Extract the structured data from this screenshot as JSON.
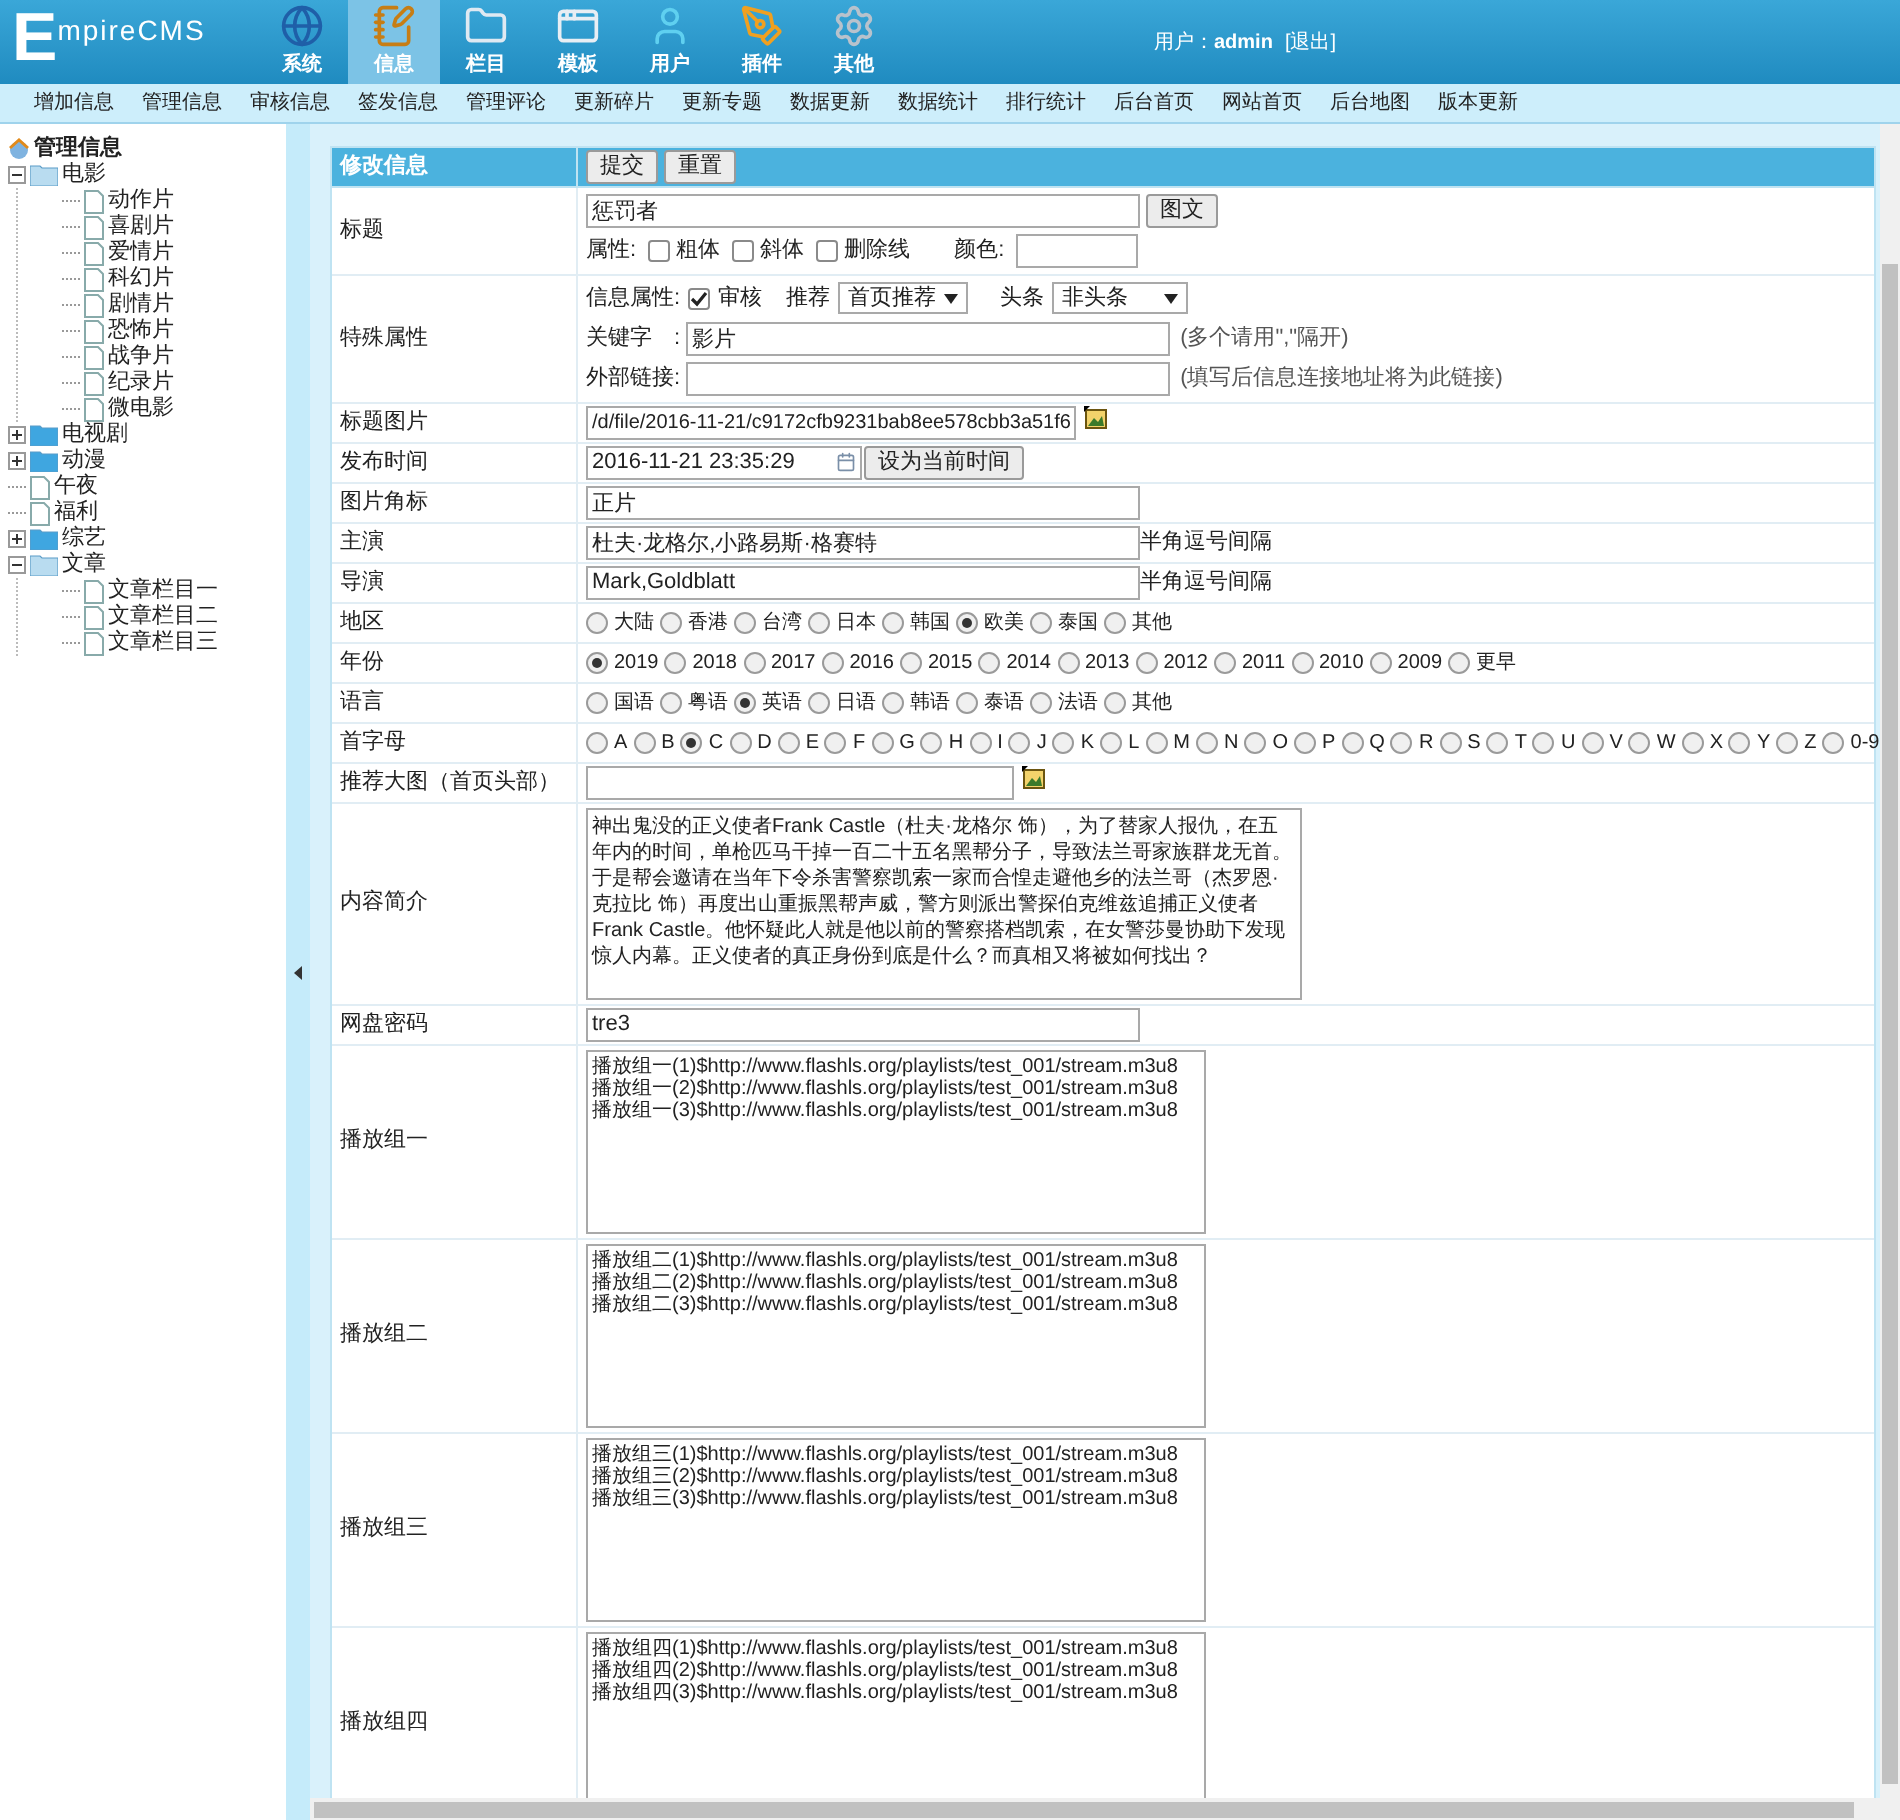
{
  "header": {
    "logo_initial": "E",
    "logo_rest": "mpireCMS",
    "nav": [
      {
        "label": "系统",
        "kind": "globe",
        "selected": false
      },
      {
        "label": "信息",
        "kind": "note",
        "selected": true
      },
      {
        "label": "栏目",
        "kind": "folder",
        "selected": false
      },
      {
        "label": "模板",
        "kind": "window",
        "selected": false
      },
      {
        "label": "用户",
        "kind": "user",
        "selected": false
      },
      {
        "label": "插件",
        "kind": "tools",
        "selected": false
      },
      {
        "label": "其他",
        "kind": "gear",
        "selected": false
      }
    ],
    "user_label": "用户：",
    "user_name": "admin",
    "logout": "[退出]"
  },
  "submenu": [
    "增加信息",
    "管理信息",
    "审核信息",
    "签发信息",
    "管理评论",
    "更新碎片",
    "更新专题",
    "数据更新",
    "数据统计",
    "排行统计",
    "后台首页",
    "网站首页",
    "后台地图",
    "版本更新"
  ],
  "tree": {
    "title": "管理信息",
    "items": [
      {
        "label": "电影",
        "kind": "folder",
        "expanded": true,
        "children": [
          {
            "label": "动作片",
            "kind": "file"
          },
          {
            "label": "喜剧片",
            "kind": "file"
          },
          {
            "label": "爱情片",
            "kind": "file"
          },
          {
            "label": "科幻片",
            "kind": "file"
          },
          {
            "label": "剧情片",
            "kind": "file"
          },
          {
            "label": "恐怖片",
            "kind": "file"
          },
          {
            "label": "战争片",
            "kind": "file"
          },
          {
            "label": "纪录片",
            "kind": "file"
          },
          {
            "label": "微电影",
            "kind": "file"
          }
        ]
      },
      {
        "label": "电视剧",
        "kind": "folder",
        "expanded": false
      },
      {
        "label": "动漫",
        "kind": "folder",
        "expanded": false
      },
      {
        "label": "午夜",
        "kind": "file"
      },
      {
        "label": "福利",
        "kind": "file"
      },
      {
        "label": "综艺",
        "kind": "folder",
        "expanded": false
      },
      {
        "label": "文章",
        "kind": "folder",
        "expanded": true,
        "children": [
          {
            "label": "文章栏目一",
            "kind": "file"
          },
          {
            "label": "文章栏目二",
            "kind": "file"
          },
          {
            "label": "文章栏目三",
            "kind": "file"
          }
        ]
      }
    ]
  },
  "form": {
    "title": "修改信息",
    "buttons": [
      "提交",
      "重置"
    ],
    "rows": [
      {
        "kind": "title",
        "label": "标题",
        "value": "惩罚者",
        "button": "图文",
        "attr_label": "属性:",
        "attrs": [
          {
            "label": "粗体",
            "checked": false
          },
          {
            "label": "斜体",
            "checked": false
          },
          {
            "label": "删除线",
            "checked": false
          }
        ],
        "color_label": "颜色:"
      },
      {
        "kind": "special",
        "label": "特殊属性",
        "info_label": "信息属性:",
        "review": {
          "label": "审核",
          "checked": true
        },
        "recommend_label": "推荐",
        "recommend": "首页推荐",
        "headline_label": "头条",
        "headline": "非头条",
        "keyword_label": "关键字　:",
        "keyword": "影片",
        "keyword_hint": "(多个请用\",\"隔开)",
        "link_label": "外部链接:",
        "link_hint": "(填写后信息连接地址将为此链接)"
      },
      {
        "kind": "image",
        "label": "标题图片",
        "value": "/d/file/2016-11-21/c9172cfb9231bab8ee578cbb3a51f6"
      },
      {
        "kind": "datetime",
        "label": "发布时间",
        "value": "2016-11-21 23:35:29",
        "button": "设为当前时间"
      },
      {
        "kind": "text",
        "label": "图片角标",
        "value": "正片"
      },
      {
        "kind": "text",
        "label": "主演",
        "value": "杜夫·龙格尔,小路易斯·格赛特",
        "hint": "半角逗号间隔"
      },
      {
        "kind": "text",
        "label": "导演",
        "value": "Mark,Goldblatt",
        "hint": "半角逗号间隔"
      },
      {
        "kind": "radio",
        "label": "地区",
        "options": [
          {
            "label": "大陆",
            "selected": false
          },
          {
            "label": "香港",
            "selected": false
          },
          {
            "label": "台湾",
            "selected": false
          },
          {
            "label": "日本",
            "selected": false
          },
          {
            "label": "韩国",
            "selected": false
          },
          {
            "label": "欧美",
            "selected": true
          },
          {
            "label": "泰国",
            "selected": false
          },
          {
            "label": "其他",
            "selected": false
          }
        ]
      },
      {
        "kind": "radio",
        "label": "年份",
        "options": [
          {
            "label": "2019",
            "selected": true
          },
          {
            "label": "2018",
            "selected": false
          },
          {
            "label": "2017",
            "selected": false
          },
          {
            "label": "2016",
            "selected": false
          },
          {
            "label": "2015",
            "selected": false
          },
          {
            "label": "2014",
            "selected": false
          },
          {
            "label": "2013",
            "selected": false
          },
          {
            "label": "2012",
            "selected": false
          },
          {
            "label": "2011",
            "selected": false
          },
          {
            "label": "2010",
            "selected": false
          },
          {
            "label": "2009",
            "selected": false
          },
          {
            "label": "更早",
            "selected": false
          }
        ]
      },
      {
        "kind": "radio",
        "label": "语言",
        "options": [
          {
            "label": "国语",
            "selected": false
          },
          {
            "label": "粤语",
            "selected": false
          },
          {
            "label": "英语",
            "selected": true
          },
          {
            "label": "日语",
            "selected": false
          },
          {
            "label": "韩语",
            "selected": false
          },
          {
            "label": "泰语",
            "selected": false
          },
          {
            "label": "法语",
            "selected": false
          },
          {
            "label": "其他",
            "selected": false
          }
        ]
      },
      {
        "kind": "radio",
        "label": "首字母",
        "options": [
          {
            "label": "A",
            "selected": false
          },
          {
            "label": "B",
            "selected": false
          },
          {
            "label": "C",
            "selected": true
          },
          {
            "label": "D",
            "selected": false
          },
          {
            "label": "E",
            "selected": false
          },
          {
            "label": "F",
            "selected": false
          },
          {
            "label": "G",
            "selected": false
          },
          {
            "label": "H",
            "selected": false
          },
          {
            "label": "I",
            "selected": false
          },
          {
            "label": "J",
            "selected": false
          },
          {
            "label": "K",
            "selected": false
          },
          {
            "label": "L",
            "selected": false
          },
          {
            "label": "M",
            "selected": false
          },
          {
            "label": "N",
            "selected": false
          },
          {
            "label": "O",
            "selected": false
          },
          {
            "label": "P",
            "selected": false
          },
          {
            "label": "Q",
            "selected": false
          },
          {
            "label": "R",
            "selected": false
          },
          {
            "label": "S",
            "selected": false
          },
          {
            "label": "T",
            "selected": false
          },
          {
            "label": "U",
            "selected": false
          },
          {
            "label": "V",
            "selected": false
          },
          {
            "label": "W",
            "selected": false
          },
          {
            "label": "X",
            "selected": false
          },
          {
            "label": "Y",
            "selected": false
          },
          {
            "label": "Z",
            "selected": false
          },
          {
            "label": "0-9",
            "selected": false
          }
        ]
      },
      {
        "kind": "image",
        "label": "推荐大图（首页头部）"
      },
      {
        "kind": "textarea",
        "label": "内容简介",
        "value": "神出鬼没的正义使者Frank Castle（杜夫·龙格尔 饰），为了替家人报仇，在五年内的时间，单枪匹马干掉一百二十五名黑帮分子，导致法兰哥家族群龙无首。于是帮会邀请在当年下令杀害警察凯索一家而合惶走避他乡的法兰哥（杰罗恩·克拉比 饰）再度出山重振黑帮声威，警方则派出警探伯克维兹追捕正义使者Frank Castle。他怀疑此人就是他以前的警察搭档凯索，在女警莎曼协助下发现惊人内幕。正义使者的真正身份到底是什么？而真相又将被如何找出？"
      },
      {
        "kind": "text",
        "label": "网盘密码",
        "value": "tre3"
      },
      {
        "kind": "playlist",
        "label": "播放组一",
        "lines": [
          "播放组一(1)$http://www.flashls.org/playlists/test_001/stream.m3u8",
          "播放组一(2)$http://www.flashls.org/playlists/test_001/stream.m3u8",
          "播放组一(3)$http://www.flashls.org/playlists/test_001/stream.m3u8"
        ]
      },
      {
        "kind": "playlist",
        "label": "播放组二",
        "lines": [
          "播放组二(1)$http://www.flashls.org/playlists/test_001/stream.m3u8",
          "播放组二(2)$http://www.flashls.org/playlists/test_001/stream.m3u8",
          "播放组二(3)$http://www.flashls.org/playlists/test_001/stream.m3u8"
        ]
      },
      {
        "kind": "playlist",
        "label": "播放组三",
        "lines": [
          "播放组三(1)$http://www.flashls.org/playlists/test_001/stream.m3u8",
          "播放组三(2)$http://www.flashls.org/playlists/test_001/stream.m3u8",
          "播放组三(3)$http://www.flashls.org/playlists/test_001/stream.m3u8"
        ]
      },
      {
        "kind": "playlist",
        "label": "播放组四",
        "lines": [
          "播放组四(1)$http://www.flashls.org/playlists/test_001/stream.m3u8",
          "播放组四(2)$http://www.flashls.org/playlists/test_001/stream.m3u8",
          "播放组四(3)$http://www.flashls.org/playlists/test_001/stream.m3u8"
        ]
      }
    ]
  }
}
